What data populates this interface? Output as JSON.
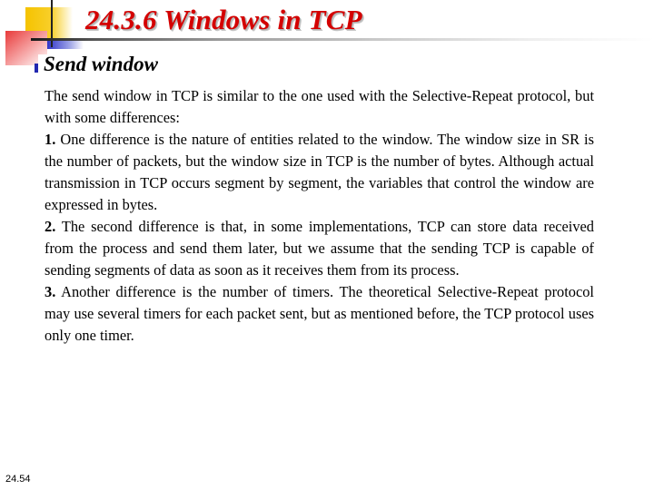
{
  "slide": {
    "title": "24.3.6  Windows in TCP",
    "subtitle": "Send window",
    "intro": "The send window in TCP is similar to the one used with the Selective-Repeat protocol, but with some differences:",
    "points": [
      {
        "number": "1.",
        "text": " One difference is the nature of entities related to the window. The window size in SR is the number of packets, but the window size in TCP is the number of bytes. Although actual transmission in TCP occurs segment by segment, the variables that control the window are expressed in bytes."
      },
      {
        "number": "2.",
        "text": " The second difference is that, in some implementations, TCP can store data received from the process and send them later, but we assume that the sending TCP is capable of sending segments of data as soon as it receives them from its process."
      },
      {
        "number": "3.",
        "text": " Another difference is the number of timers. The theoretical Selective-Repeat protocol may use several timers for each packet sent, but as mentioned before, the TCP protocol uses only one timer."
      }
    ],
    "page_number": "24.54"
  },
  "colors": {
    "title": "#d40000",
    "bullet": "#2228b0",
    "deco_yellow": "#f5c300",
    "deco_red": "#e83a3a",
    "deco_blue": "#3035c8"
  }
}
